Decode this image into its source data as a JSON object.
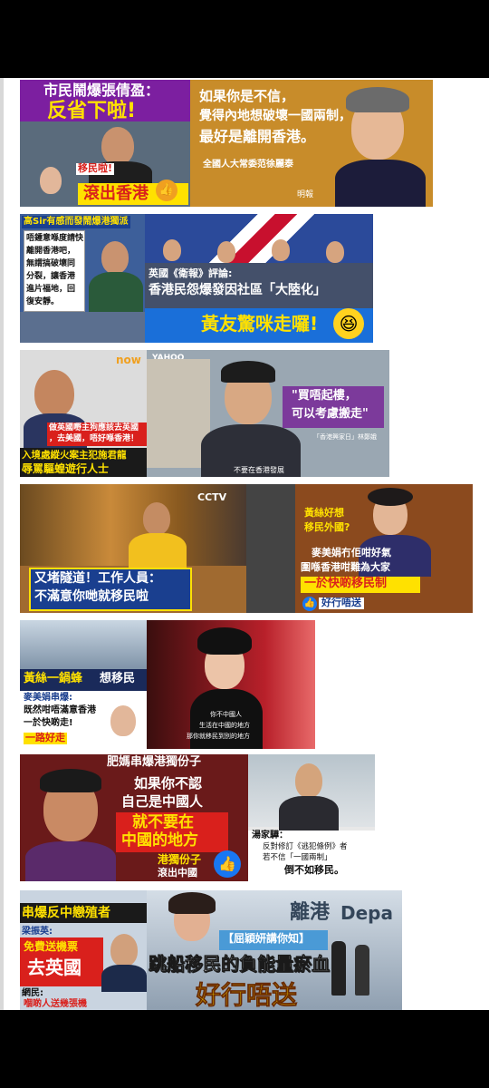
{
  "rows": [
    {
      "a": {
        "headline_1": "市民鬧爆張倩盈：",
        "headline_2": "反省下啦!",
        "tag": "移民啦!",
        "banner": "滾出香港"
      },
      "b": {
        "quote_1": "如果你是不信，",
        "quote_2": "覺得內地想破壞一國兩制，",
        "quote_3": "最好是離開香港。",
        "attribution": "全國人大常委范徐麗泰",
        "source": "明報"
      }
    },
    {
      "a": {
        "header": "高Sir有感而發鬧爆港獨派",
        "speech_1": "唔鍾意喺度請快",
        "speech_2": "離開香港吧，",
        "speech_3": "無謂搞破壞同",
        "speech_4": "分裂，讓香港",
        "speech_5": "進片福地，回",
        "speech_6": "復安靜。"
      },
      "b": {
        "caption_1": "英國《衛報》評論:",
        "caption_2": "香港民怨爆發因社區「大陸化」",
        "banner": "黃友驚咪走囉!"
      }
    },
    {
      "a": {
        "logo": "now",
        "caption_1": "做英國嘢主狗應該去英國",
        "caption_2": "，去美國，唔好喺香港！",
        "headline_1": "入境處縱火案主犯施君龍",
        "headline_2": "辱罵驅蝗遊行人士"
      },
      "b": {
        "logo": "YAHOO",
        "quote_1": "\"買唔起樓，",
        "quote_2": "可以考慮搬走\"",
        "source": "「香港興家日」林鄭娥",
        "subtitle": "不要在香港發展"
      }
    },
    {
      "a": {
        "logo": "CCTV",
        "banner_1": "又堵隧道！工作人員：",
        "banner_2": "不滿意你哋就移民啦"
      },
      "b": {
        "caption_1": "黃絲好想",
        "caption_2": "移民外國?",
        "caption_3": "麥美娟冇佢咁好氣",
        "caption_4": "圍喺香港咁難為大家",
        "caption_5": "一於快啲移民制",
        "tag": "好行唔送"
      }
    },
    {
      "a": {
        "headline_1": "黃絲一鍋蜂",
        "headline_2": "想移民",
        "speaker": "麥美娟串爆:",
        "line_1": "既然咁唔滿意香港",
        "line_2": "一於快啲走!",
        "farewell": "一路好走"
      },
      "b": {
        "sub_1": "你不中國人",
        "sub_2": "生活在中國的地方",
        "sub_3": "那你就移民到別的地方"
      }
    },
    {
      "a": {
        "header": "肥媽串爆港獨份子",
        "quote_1": "如果你不認",
        "quote_2": "自己是中國人",
        "quote_3": "就不要在",
        "quote_4": "中國的地方",
        "tag_1": "港獨份子",
        "tag_2": "滾出中國"
      },
      "b": {
        "speaker": "湯家驊：",
        "quote_1": "反對修訂《逃犯條例》者",
        "quote_2": "若不信「一國兩制」",
        "quote_3": "倒不如移民。"
      }
    },
    {
      "a": {
        "headline": "串爆反中戀殖者",
        "speaker": "梁振英:",
        "offer_1": "免費送機票",
        "offer_2": "去英國",
        "netizen": "網民:",
        "netizen_line": "嗰啲人送幾張機"
      },
      "b": {
        "sign_1": "離港",
        "sign_2": "Depa",
        "label": "【屈穎妍講你知】",
        "headline_1": "跳船移民的負能量瘀血",
        "headline_2": "好行唔送"
      }
    }
  ],
  "colors": {
    "page_bg": "#000000",
    "sheet_bg": "#ffffff",
    "banner_red": "#d9201c",
    "banner_blue": "#1a3f8f",
    "highlight_yellow": "#ffe100",
    "purple": "#7c3a9b"
  }
}
